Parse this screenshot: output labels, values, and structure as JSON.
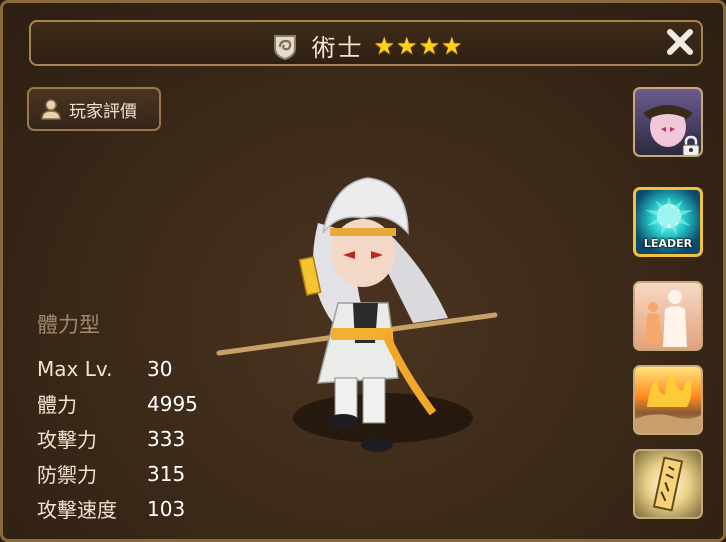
{
  "header": {
    "title": "術士",
    "stars": [
      "★",
      "★",
      "★",
      "★"
    ],
    "close_icon": "close-x"
  },
  "review": {
    "label": "玩家評價"
  },
  "stats": {
    "type": "體力型",
    "rows": [
      {
        "label": "Max Lv.",
        "value": "30"
      },
      {
        "label": "體力",
        "value": "4995"
      },
      {
        "label": "攻擊力",
        "value": "333"
      },
      {
        "label": "防禦力",
        "value": "315"
      },
      {
        "label": "攻擊速度",
        "value": "103"
      }
    ]
  },
  "side_buttons": {
    "leader_label": "LEADER"
  },
  "colors": {
    "accent": "#ffd21a",
    "border": "#a88452"
  }
}
